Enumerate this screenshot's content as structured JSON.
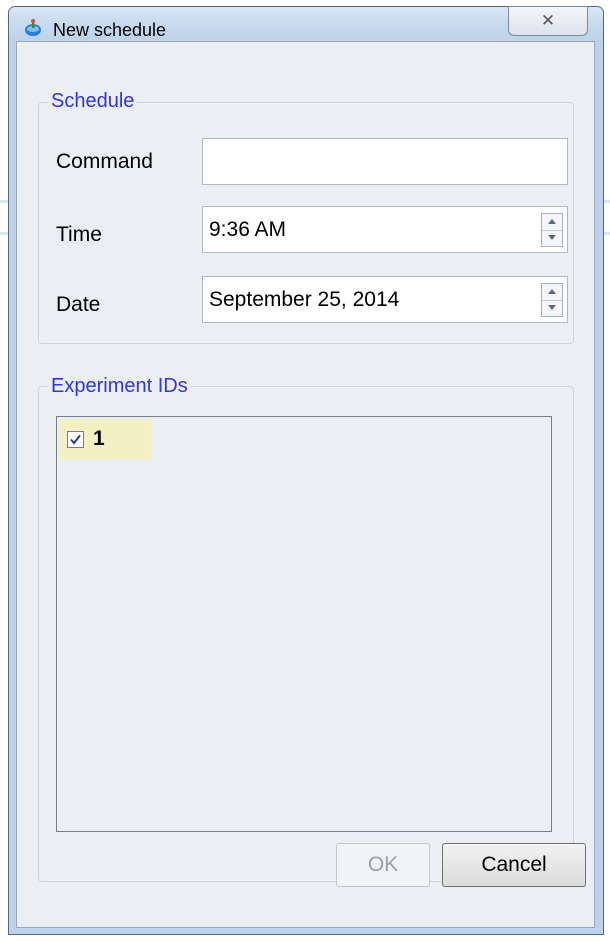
{
  "window": {
    "title": "New schedule",
    "close_symbol": "✕",
    "icon": "app-logo-icon"
  },
  "schedule_group": {
    "legend": "Schedule",
    "command": {
      "label": "Command",
      "value": ""
    },
    "time": {
      "label": "Time",
      "value": "9:36 AM"
    },
    "date": {
      "label": "Date",
      "value": "September 25, 2014"
    }
  },
  "experiments_group": {
    "legend": "Experiment IDs",
    "items": [
      {
        "label": "1",
        "checked": true
      }
    ]
  },
  "buttons": {
    "ok": "OK",
    "cancel": "Cancel"
  },
  "colors": {
    "legend": "#2e33f0",
    "selected_item": "#f3f1c4",
    "dialog_bg": "#ebeef2"
  }
}
